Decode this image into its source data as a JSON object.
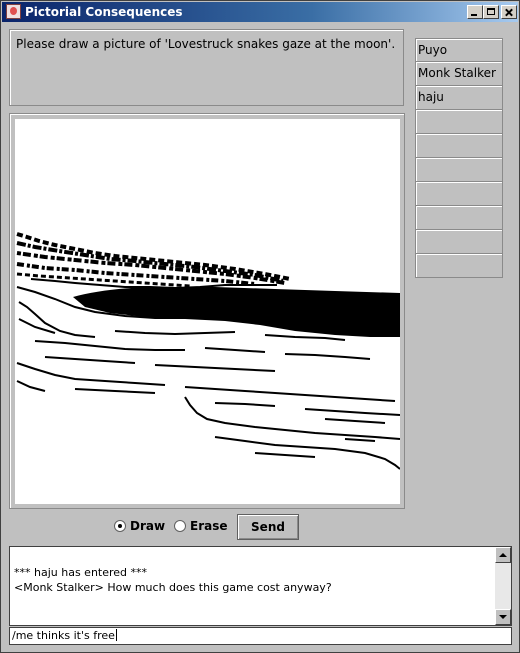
{
  "window": {
    "title": "Pictorial Consequences"
  },
  "prompt": {
    "text": "Please draw a picture of 'Lovestruck snakes gaze at the moon'."
  },
  "players": [
    "Puyo",
    "Monk Stalker",
    "haju",
    "",
    "",
    "",
    "",
    "",
    "",
    ""
  ],
  "tools": {
    "draw_label": "Draw",
    "erase_label": "Erase",
    "selected": "Draw",
    "send_label": "Send"
  },
  "chat": {
    "lines": [
      "*** haju has entered ***",
      "<Monk Stalker> How much does this game cost anyway?"
    ],
    "input_value": "/me thinks it's free"
  },
  "colors": {
    "titlebar_start": "#0a246a",
    "titlebar_end": "#a6caf0",
    "panel_bg": "#c0c0c0",
    "ink": "#000000",
    "paper": "#ffffff"
  }
}
